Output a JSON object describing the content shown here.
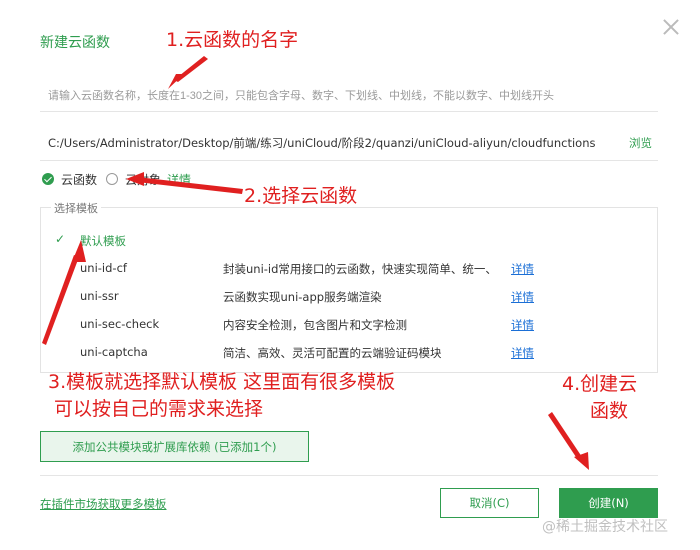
{
  "dialog": {
    "title": "新建云函数",
    "name_placeholder": "请输入云函数名称，长度在1-30之间，只能包含字母、数字、下划线、中划线，不能以数字、中划线开头",
    "path": "C:/Users/Administrator/Desktop/前端/练习/uniCloud/阶段2/quanzi/uniCloud-aliyun/cloudfunctions",
    "browse_label": "浏览",
    "type_options": [
      {
        "label": "云函数",
        "selected": true
      },
      {
        "label": "云对象",
        "selected": false
      }
    ],
    "type_detail": "详情",
    "template_legend": "选择模板",
    "templates": [
      {
        "name": "默认模板",
        "desc": "",
        "detail": "",
        "selected": true
      },
      {
        "name": "uni-id-cf",
        "desc": "封装uni-id常用接口的云函数，快速实现简单、统一、",
        "detail": "详情",
        "selected": false
      },
      {
        "name": "uni-ssr",
        "desc": "云函数实现uni-app服务端渲染",
        "detail": "详情",
        "selected": false
      },
      {
        "name": "uni-sec-check",
        "desc": "内容安全检测，包含图片和文字检测",
        "detail": "详情",
        "selected": false
      },
      {
        "name": "uni-captcha",
        "desc": "简洁、高效、灵活可配置的云端验证码模块",
        "detail": "详情",
        "selected": false
      }
    ],
    "add_module_label": "添加公共模块或扩展库依赖 (已添加1个)",
    "market_link": "在插件市场获取更多模板",
    "cancel_label": "取消(C)",
    "create_label": "创建(N)"
  },
  "annotations": {
    "a1": "1.云函数的名字",
    "a2": "2.选择云函数",
    "a3_line1": "3.模板就选择默认模板 这里面有很多模板",
    "a3_line2": "可以按自己的需求来选择",
    "a4_line1": "4.创建云",
    "a4_line2": "函数"
  },
  "watermark": "@稀土掘金技术社区",
  "colors": {
    "accent": "#2f9d4f",
    "link_blue": "#1b6fd6",
    "annotation_red": "#e02020"
  },
  "icons": {
    "close": "close-icon",
    "checkmark": "checkmark-icon"
  }
}
